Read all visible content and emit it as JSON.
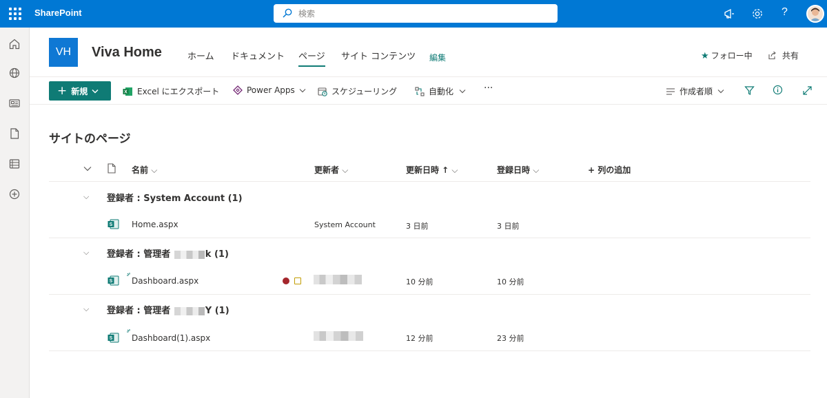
{
  "topbar": {
    "app_name": "SharePoint",
    "search_placeholder": "検索",
    "help_label": "?"
  },
  "site": {
    "logo_text": "VH",
    "title": "Viva Home",
    "nav": [
      "ホーム",
      "ドキュメント",
      "ページ",
      "サイト コンテンツ"
    ],
    "edit_label": "編集",
    "follow_label": "フォロー中",
    "share_label": "共有"
  },
  "commandbar": {
    "new_label": "新規",
    "excel_label": "Excel にエクスポート",
    "powerapps_label": "Power Apps",
    "schedule_label": "スケジューリング",
    "automate_label": "自動化",
    "more_label": "···",
    "view_label": "作成者順"
  },
  "list": {
    "title": "サイトのページ",
    "columns": {
      "name": "名前",
      "modified_by": "更新者",
      "modified": "更新日時 ↑",
      "created": "登録日時",
      "add_column": "+ 列の追加"
    },
    "groups": [
      {
        "label_prefix": "登録者 : System Account (1)",
        "label_suffix": "",
        "file": "Home.aspx",
        "modified_by": "System Account",
        "modified": "3 日前",
        "created": "3 日前"
      },
      {
        "label_prefix": "登録者 : 管理者",
        "label_suffix": "k (1)",
        "file": "Dashboard.aspx",
        "modified_by": "",
        "modified": "10 分前",
        "created": "10 分前"
      },
      {
        "label_prefix": "登録者 : 管理者",
        "label_suffix": "Y (1)",
        "file": "Dashboard(1).aspx",
        "modified_by": "",
        "modified": "12 分前",
        "created": "23 分前"
      }
    ]
  },
  "colors": {
    "topbar": "#0078d4",
    "accent": "#0f7b75",
    "logo": "#0f78d4"
  }
}
